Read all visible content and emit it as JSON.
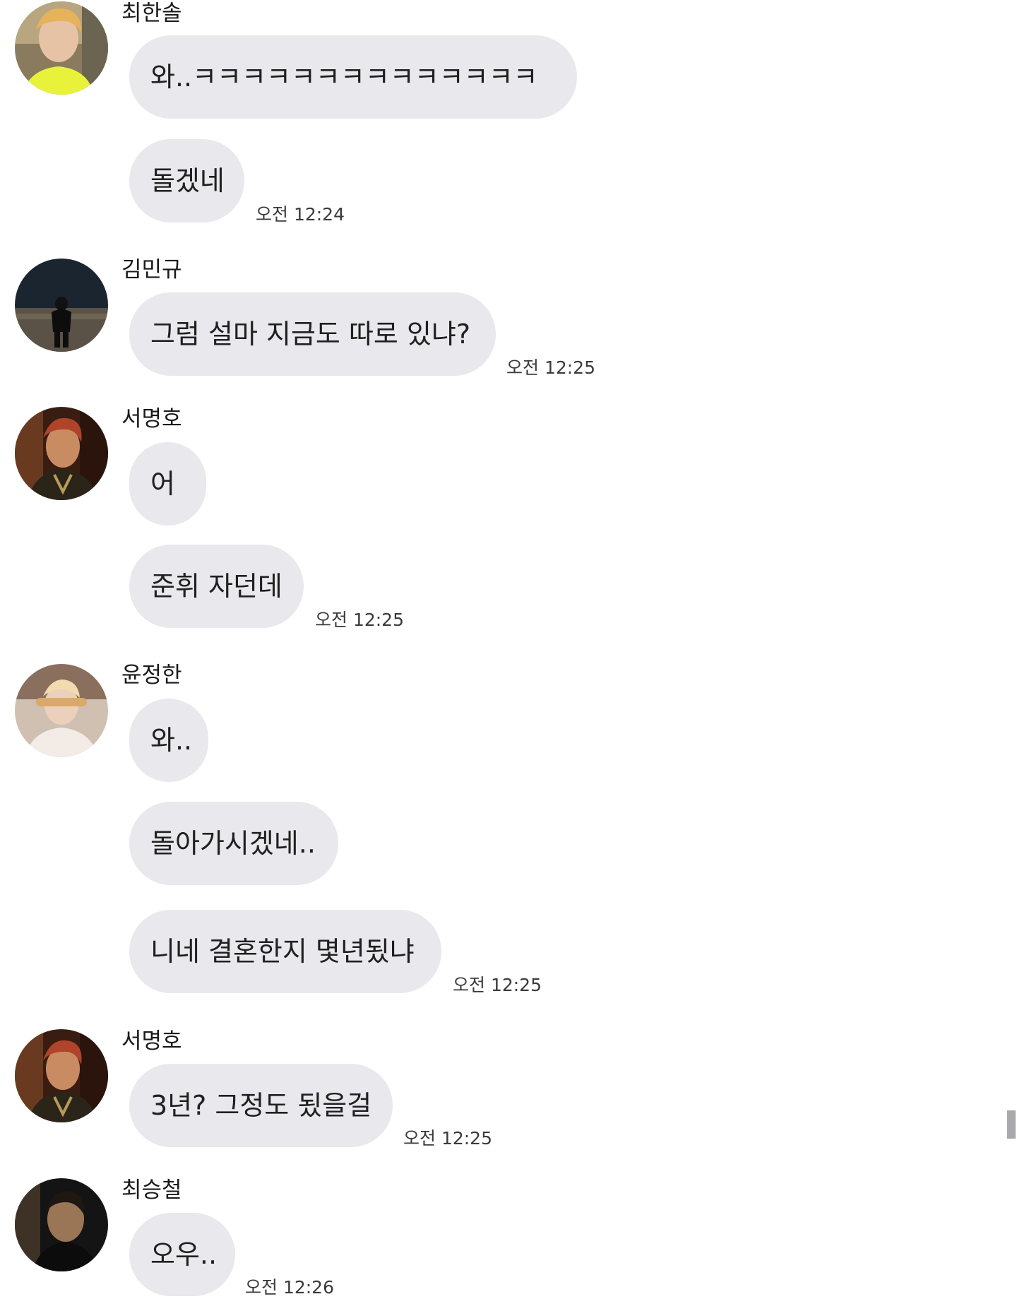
{
  "messages": [
    {
      "sender": "최한솔",
      "avatar": "avatar-yellow-shirt",
      "bubbles": [
        "와..ㅋㅋㅋㅋㅋㅋㅋㅋㅋㅋㅋㅋㅋㅋ",
        "돌겠네"
      ],
      "time": "오전 12:24"
    },
    {
      "sender": "김민규",
      "avatar": "avatar-night-street",
      "bubbles": [
        "그럼 설마 지금도 따로 있냐?"
      ],
      "time": "오전 12:25"
    },
    {
      "sender": "서명호",
      "avatar": "avatar-red-hair",
      "bubbles": [
        "어",
        "준휘 자던데"
      ],
      "time": "오전 12:25"
    },
    {
      "sender": "윤정한",
      "avatar": "avatar-covered-eyes",
      "bubbles": [
        "와..",
        "돌아가시겠네..",
        "니네 결혼한지 몇년됬냐"
      ],
      "time": "오전 12:25"
    },
    {
      "sender": "서명호",
      "avatar": "avatar-red-hair",
      "bubbles": [
        "3년? 그정도 됬을걸"
      ],
      "time": "오전 12:25"
    },
    {
      "sender": "최승철",
      "avatar": "avatar-dark-portrait",
      "bubbles": [
        "오우.."
      ],
      "time": "오전 12:26"
    }
  ],
  "colors": {
    "bubble": "#e8e8ed",
    "background": "#ffffff",
    "text": "#202020",
    "timestamp": "#3a3a3a",
    "scrollbar": "#a9a9ad"
  }
}
